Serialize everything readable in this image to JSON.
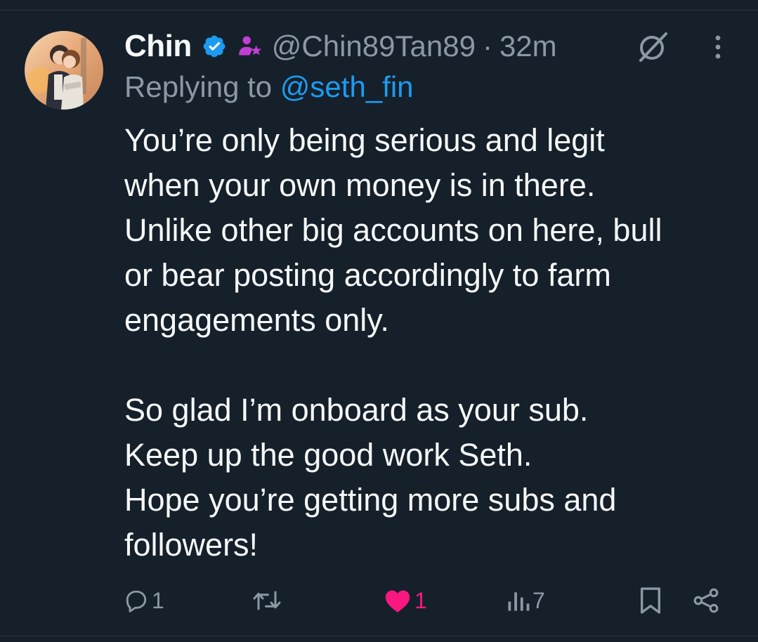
{
  "tweet": {
    "author": {
      "display_name": "Chin",
      "handle": "@Chin89Tan89",
      "verified": true,
      "avatar_icon": "user-avatar-illustration"
    },
    "dot_separator": "·",
    "time_ago": "32m",
    "replying_prefix": "Replying to ",
    "replying_to": "@seth_fin",
    "body_lines": [
      "You’re only being serious and legit",
      "when your own money is in there.",
      "Unlike other big accounts on here, bull",
      "or bear posting accordingly to farm",
      "engagements only.",
      "",
      "So glad I’m onboard as your sub.",
      "Keep up the good work Seth.",
      "Hope you’re getting more subs and",
      "followers!"
    ],
    "actions": {
      "reply_count": "1",
      "retweet_count": "",
      "like_count": "1",
      "view_count": "7"
    }
  },
  "icons": {
    "verified": "verified-badge-icon",
    "affiliate": "subscriber-badge-icon",
    "grok": "grok-icon",
    "more": "more-options-icon",
    "reply": "reply-icon",
    "retweet": "retweet-icon",
    "like": "heart-icon",
    "views": "views-icon",
    "bookmark": "bookmark-icon",
    "share": "share-icon"
  },
  "colors": {
    "background": "#15202b",
    "text_primary": "#f7f9f9",
    "text_secondary": "#8b98a5",
    "accent_blue": "#1d9bf0",
    "like_pink": "#f91880",
    "affiliate_purple": "#c23fd6"
  }
}
